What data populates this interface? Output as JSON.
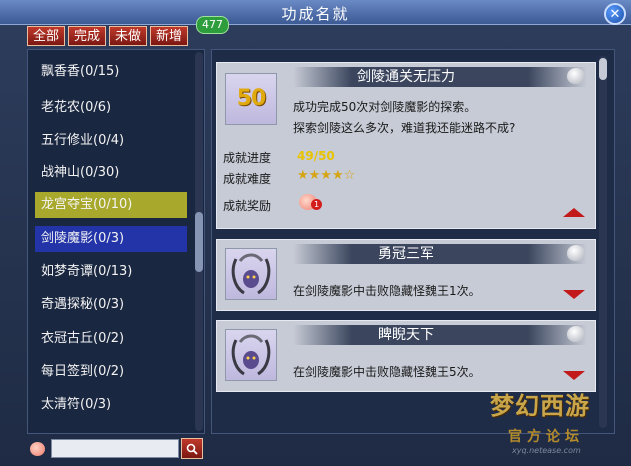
{
  "window": {
    "title": "功成名就"
  },
  "tabs": [
    {
      "label": "全部"
    },
    {
      "label": "完成"
    },
    {
      "label": "未做"
    },
    {
      "label": "新增"
    }
  ],
  "badge": {
    "count": "477"
  },
  "categories": [
    {
      "label": "飘香香(0/15)"
    },
    {
      "label": "老花农(0/6)"
    },
    {
      "label": "五行修业(0/4)"
    },
    {
      "label": "战神山(0/30)"
    },
    {
      "label": "龙宫夺宝(0/10)"
    },
    {
      "label": "剑陵魔影(0/3)"
    },
    {
      "label": "如梦奇谭(0/13)"
    },
    {
      "label": "奇遇探秘(0/3)"
    },
    {
      "label": "衣冠古丘(0/2)"
    },
    {
      "label": "每日签到(0/2)"
    },
    {
      "label": "太清符(0/3)"
    }
  ],
  "search": {
    "placeholder": ""
  },
  "achievements": [
    {
      "title": "剑陵通关无压力",
      "icon_text": "50",
      "desc1": "成功完成50次对剑陵魔影的探索。",
      "desc2": "探索剑陵这么多次，难道我还能迷路不成?",
      "progress_label": "成就进度",
      "progress_value": "49/50",
      "progress_fraction": 0.98,
      "difficulty_label": "成就难度",
      "difficulty_stars": "★★★★☆",
      "reward_label": "成就奖励",
      "reward_count": "1"
    },
    {
      "title": "勇冠三军",
      "desc1": "在剑陵魔影中击败隐藏怪魏王1次。"
    },
    {
      "title": "睥睨天下",
      "desc1": "在剑陵魔影中击败隐藏怪魏王5次。"
    }
  ],
  "watermark": {
    "logo": "梦幻西游",
    "sub": "官方论坛",
    "url": "xyq.netease.com"
  },
  "colors": {
    "tab_red": "#a52a1e",
    "highlight_gold": "#a8a92c",
    "highlight_blue": "#2234a8",
    "progress_yellow": "#e8c400",
    "badge_green": "#2e9d3c"
  }
}
